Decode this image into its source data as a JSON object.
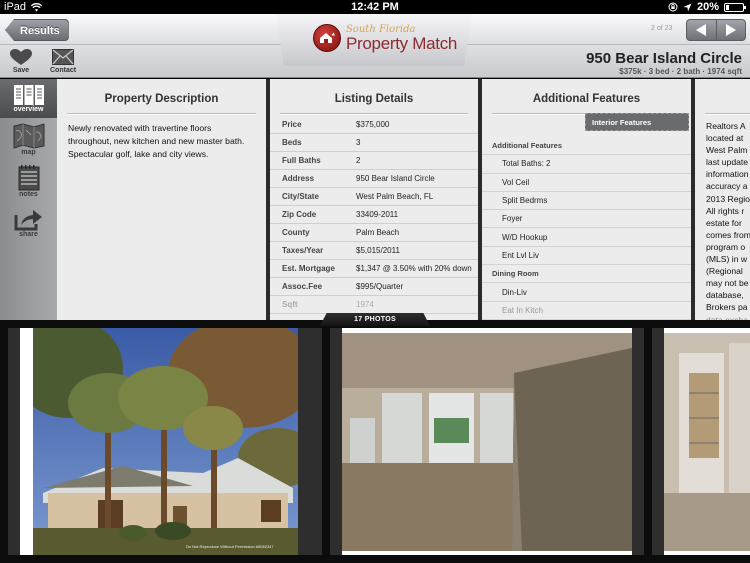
{
  "status_bar": {
    "device": "iPad",
    "time": "12:42 PM",
    "battery": "20%",
    "battery_level": 0.2
  },
  "header": {
    "back_button": "Results",
    "logo": {
      "script_text": "South Florida",
      "name": "Property Match"
    },
    "pager_text": "2 of 23",
    "toolbar": {
      "save": "Save",
      "contact": "Contact"
    },
    "property_title": "950 Bear Island Circle",
    "property_summary": "$375k  ·  3 bed  ·  2 bath  ·  1974 sqft"
  },
  "sidebar": {
    "items": [
      {
        "label": "overview",
        "icon": "overview-icon",
        "active": true
      },
      {
        "label": "map",
        "icon": "map-icon",
        "active": false
      },
      {
        "label": "notes",
        "icon": "notes-icon",
        "active": false
      },
      {
        "label": "share",
        "icon": "share-icon",
        "active": false
      }
    ]
  },
  "description": {
    "title": "Property Description",
    "text": "Newly renovated with travertine floors throughout, new kitchen and new master bath. Spectacular golf, lake and city views."
  },
  "listing": {
    "title": "Listing Details",
    "rows": [
      {
        "label": "Price",
        "value": "$375,000"
      },
      {
        "label": "Beds",
        "value": "3"
      },
      {
        "label": "Full Baths",
        "value": "2"
      },
      {
        "label": "Address",
        "value": "950 Bear Island Circle"
      },
      {
        "label": "City/State",
        "value": "West Palm Beach, FL"
      },
      {
        "label": "Zip Code",
        "value": "33409-2011"
      },
      {
        "label": "County",
        "value": "Palm Beach"
      },
      {
        "label": "Taxes/Year",
        "value": "$5,015/2011"
      },
      {
        "label": "Est. Mortgage",
        "value": "$1,347 @ 3.50% with 20% down"
      },
      {
        "label": "Assoc.Fee",
        "value": "$995/Quarter"
      },
      {
        "label": "Sqft",
        "value": "1974"
      }
    ]
  },
  "features": {
    "title": "Additional Features",
    "category_button": "Interior Features",
    "rows": [
      {
        "text": "Additional Features",
        "type": "head"
      },
      {
        "text": "Total Baths: 2",
        "type": "item"
      },
      {
        "text": "Vol Ceil",
        "type": "item"
      },
      {
        "text": "Split Bedrms",
        "type": "item"
      },
      {
        "text": "Foyer",
        "type": "item"
      },
      {
        "text": "W/D Hookup",
        "type": "item"
      },
      {
        "text": "Ent Lvl Liv",
        "type": "item"
      },
      {
        "text": "Dining Room",
        "type": "head"
      },
      {
        "text": "Din-Liv",
        "type": "item"
      },
      {
        "text": "Eat In Kitch",
        "type": "item"
      }
    ]
  },
  "disclaimer": {
    "lines": [
      "Realtors A",
      "located at",
      "West Palm",
      "last update",
      "information",
      "accuracy a",
      "2013 Regio",
      "All rights r",
      "estate for",
      "comes from",
      "program o",
      "(MLS) in w",
      "(Regional",
      "may not be",
      "database,",
      "Brokers pa",
      "data excha"
    ]
  },
  "photos": {
    "count_label": "17 PHOTOS",
    "items": [
      {
        "alt": "exterior-house-with-palm-trees",
        "watermark": "Do Not Reproduce Without Permission #5082347"
      },
      {
        "alt": "interior-living-room-travertine-floor"
      },
      {
        "alt": "interior-mirrored-wall-niche"
      }
    ]
  }
}
